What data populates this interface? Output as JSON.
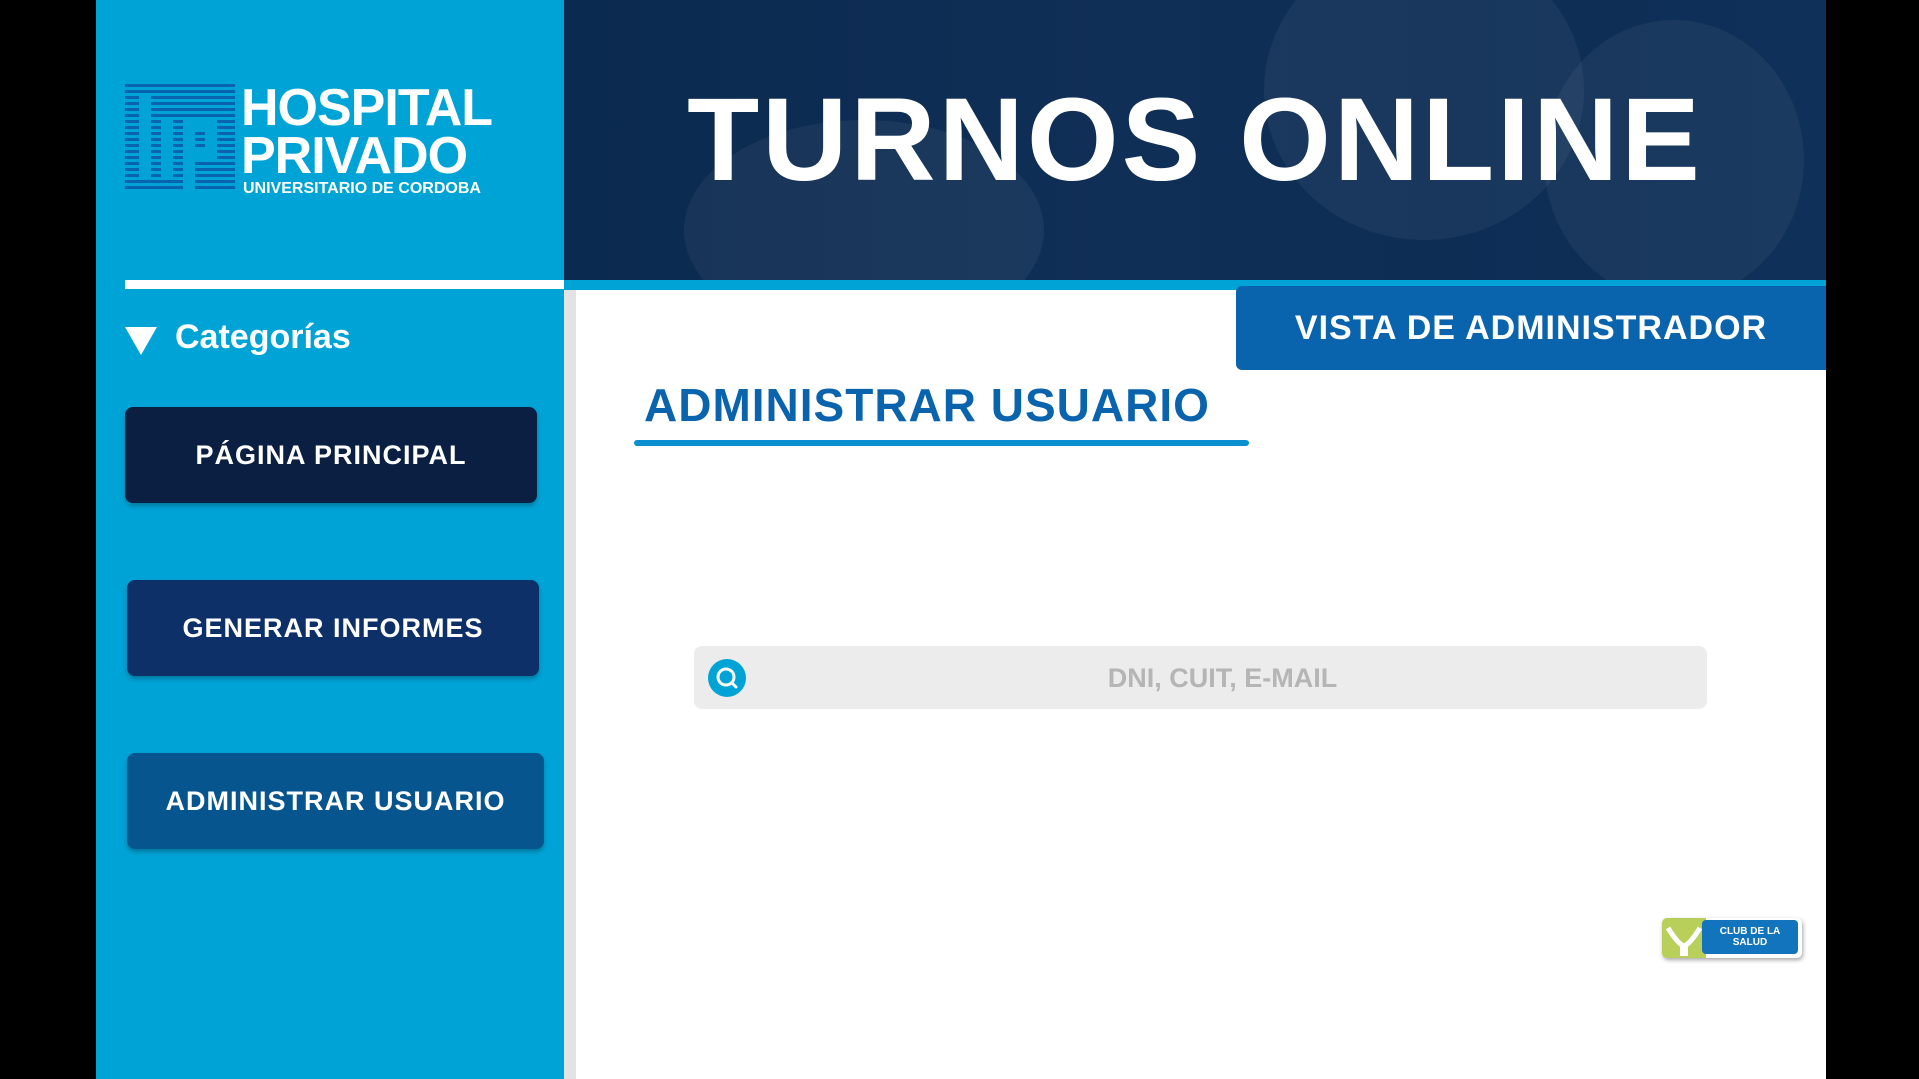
{
  "brand": {
    "logo_line1": "HOSPITAL",
    "logo_line2": "PRIVADO",
    "logo_line3": "UNIVERSITARIO DE CORDOBA",
    "logo_icon": "hp-monogram-icon"
  },
  "header": {
    "title": "TURNOS ONLINE"
  },
  "sidebar": {
    "section_label": "Categorías",
    "section_icon": "triangle-down-icon",
    "items": [
      {
        "label": "PÁGINA PRINCIPAL"
      },
      {
        "label": "GENERAR INFORMES"
      },
      {
        "label": "ADMINISTRAR USUARIO"
      }
    ]
  },
  "main": {
    "badge": "VISTA DE ADMINISTRADOR",
    "page_title": "ADMINISTRAR USUARIO",
    "search": {
      "placeholder": "DNI, CUIT, E-MAIL",
      "icon": "search-icon"
    }
  },
  "footer": {
    "partner_logo_text": "CLUB DE LA SALUD"
  },
  "colors": {
    "sidebar": "#00a3d6",
    "header": "#0b2a4f",
    "accent": "#0a63ad",
    "nav_home": "#0a1f41",
    "nav_reports": "#0c3067",
    "nav_users": "#06558f"
  }
}
